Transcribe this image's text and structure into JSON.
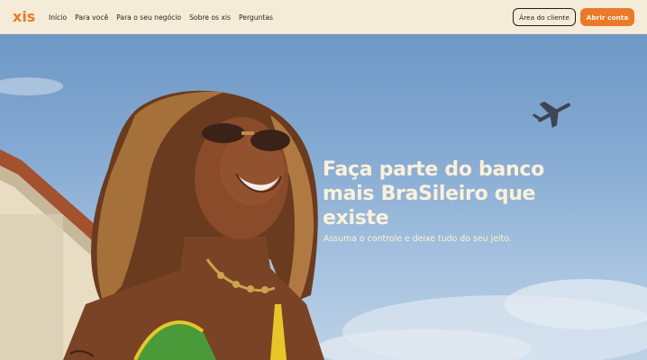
{
  "brand": {
    "logo_text": "xis",
    "accent_color": "#ea7a2a"
  },
  "nav": {
    "items": [
      {
        "label": "Início"
      },
      {
        "label": "Para você"
      },
      {
        "label": "Para o seu negócio"
      },
      {
        "label": "Sobre os xis"
      },
      {
        "label": "Perguntas"
      }
    ],
    "client_area_label": "Área do cliente",
    "open_account_label": "Abrir conta"
  },
  "hero": {
    "headline_line1": "Faça parte do banco",
    "headline_line2": "mais BraSileiro que",
    "headline_line3": "existe",
    "subheadline": "Assuma o controle e deixe tudo do seu jeito."
  }
}
